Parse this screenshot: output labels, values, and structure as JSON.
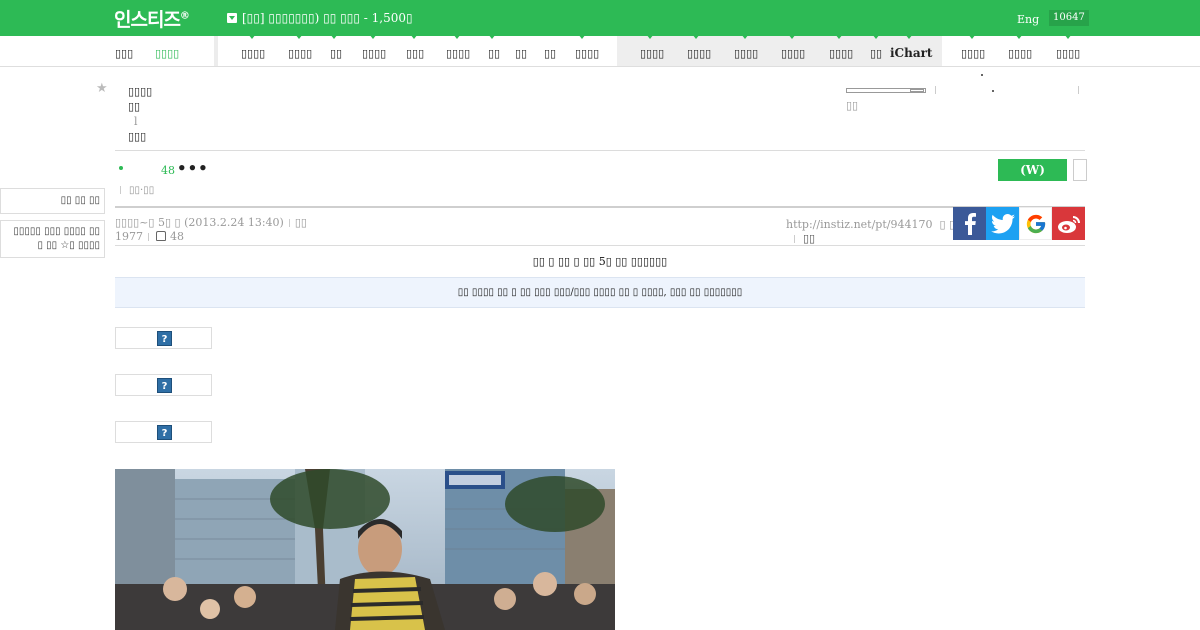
{
  "topbar": {
    "logo": "인스티즈",
    "logo_mark": "®",
    "notice": "[▯▯] ▯▯▯▯▯▯▯) ▯▯ ▯▯▯ - 1,500▯",
    "lang": "Eng",
    "counter": "10647",
    "color": "#2dba55"
  },
  "nav": {
    "items": [
      {
        "label": "▯▯▯"
      },
      {
        "label": "▯▯▯▯"
      },
      {
        "label": "▯▯▯▯"
      },
      {
        "label": "▯▯▯▯"
      },
      {
        "label": "▯▯"
      },
      {
        "label": "▯▯▯▯"
      },
      {
        "label": "▯▯▯"
      },
      {
        "label": "▯▯▯▯"
      },
      {
        "label": "▯▯"
      },
      {
        "label": "▯▯"
      },
      {
        "label": "▯▯"
      },
      {
        "label": "▯▯▯▯"
      },
      {
        "label": "▯▯▯▯"
      },
      {
        "label": "▯▯▯▯"
      },
      {
        "label": "▯▯▯▯"
      },
      {
        "label": "▯▯▯▯"
      },
      {
        "label": "▯▯▯▯"
      },
      {
        "label": "▯▯"
      },
      {
        "label": "iChart"
      },
      {
        "label": "▯▯▯▯"
      },
      {
        "label": "▯▯▯▯"
      },
      {
        "label": "▯▯▯▯"
      }
    ]
  },
  "header": {
    "lines": [
      "▯▯▯▯",
      "▯▯",
      "l",
      "▯▯▯"
    ],
    "right_label": "▯▯"
  },
  "list": {
    "reply_count": "48",
    "more": "•••",
    "write_label": "(W)",
    "sub_label": "▯▯·▯▯"
  },
  "sidebar": {
    "box1": "▯▯ ▯▯ ▯▯",
    "box2": "▯▯▯▯▯ ▯▯▯ ▯▯▯▯ ▯▯ ▯ ▯▯ ☆▯ ▯▯▯▯"
  },
  "post": {
    "author": "▯▯▯▯~▯",
    "when": "5▯ ▯ (2013.2.24 13:40)",
    "views_label": "▯▯",
    "views": "1977",
    "likes": "48",
    "url": "http://instiz.net/pt/944170",
    "url_action": "▯ ▯▯▯",
    "extra_action": "▯▯",
    "title": "▯▯ ▯ ▯▯  ▯ ▯▯ 5▯ ▯▯ ▯▯▯▯▯▯",
    "notice": "▯▯ ▯▯▯▯ ▯▯ ▯ ▯▯ ▯▯▯ ▯▯▯/▯▯▯ ▯▯▯▯ ▯▯ ▯ ▯▯▯▯, ▯▯▯ ▯▯ ▯▯▯▯▯▯▯"
  },
  "images": {
    "placeholder_glyph": "?"
  }
}
